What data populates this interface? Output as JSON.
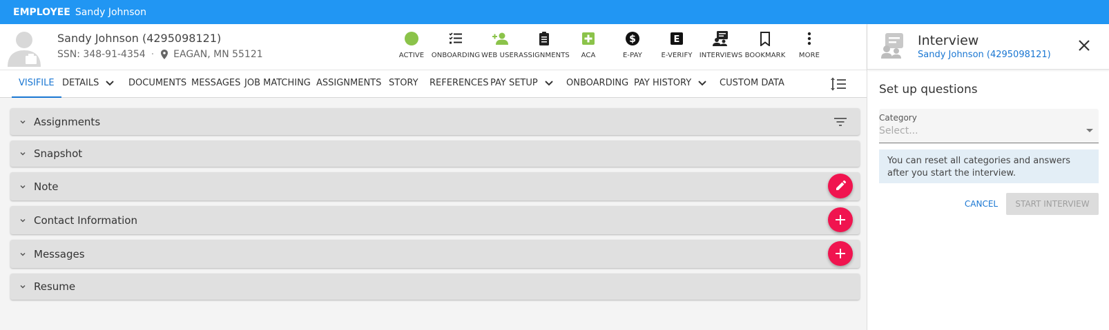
{
  "topbar": {
    "kind": "EMPLOYEE",
    "name": "Sandy Johnson"
  },
  "employee": {
    "name": "Sandy Johnson (4295098121)",
    "ssn": "SSN: 348-91-4354",
    "separator": "·",
    "location": "EAGAN, MN 55121"
  },
  "actions": [
    {
      "label": "ACTIVE",
      "icon": "active-status-icon",
      "color": "#8bc34a"
    },
    {
      "label": "ONBOARDING",
      "icon": "checklist-icon"
    },
    {
      "label": "WEB USER",
      "icon": "add-user-icon",
      "color": "#8bc34a"
    },
    {
      "label": "ASSIGNMENTS",
      "icon": "clipboard-icon"
    },
    {
      "label": "ACA",
      "icon": "plus-square-icon",
      "color": "#8bc34a"
    },
    {
      "label": "E-PAY",
      "icon": "dollar-icon"
    },
    {
      "label": "E-VERIFY",
      "icon": "e-badge-icon"
    },
    {
      "label": "INTERVIEWS",
      "icon": "interview-icon"
    },
    {
      "label": "BOOKMARK",
      "icon": "bookmark-icon"
    },
    {
      "label": "MORE",
      "icon": "more-vertical-icon"
    }
  ],
  "tabs": [
    {
      "label": "VISIFILE",
      "active": true
    },
    {
      "label": "DETAILS",
      "dropdown": true
    },
    {
      "label": "DOCUMENTS"
    },
    {
      "label": "MESSAGES"
    },
    {
      "label": "JOB MATCHING"
    },
    {
      "label": "ASSIGNMENTS"
    },
    {
      "label": "STORY"
    },
    {
      "label": "REFERENCES"
    },
    {
      "label": "PAY SETUP",
      "dropdown": true
    },
    {
      "label": "ONBOARDING"
    },
    {
      "label": "PAY HISTORY",
      "dropdown": true
    },
    {
      "label": "CUSTOM DATA"
    }
  ],
  "panels": [
    {
      "title": "Assignments",
      "tool": "filter-icon"
    },
    {
      "title": "Snapshot"
    },
    {
      "title": "Note",
      "tool": "edit-fab"
    },
    {
      "title": "Contact Information",
      "tool": "add-fab"
    },
    {
      "title": "Messages",
      "tool": "add-fab"
    },
    {
      "title": "Resume"
    }
  ],
  "drawer": {
    "title": "Interview",
    "subtitle": "Sandy Johnson (4295098121)",
    "section_title": "Set up questions",
    "category_label": "Category",
    "category_placeholder": "Select...",
    "info_text": "You can reset all categories and answers after you start the interview.",
    "cancel_label": "CANCEL",
    "start_label": "START INTERVIEW"
  },
  "colors": {
    "primary": "#2196f3",
    "link": "#1976d2",
    "fab": "#f0144f",
    "status_green": "#8bc34a"
  }
}
